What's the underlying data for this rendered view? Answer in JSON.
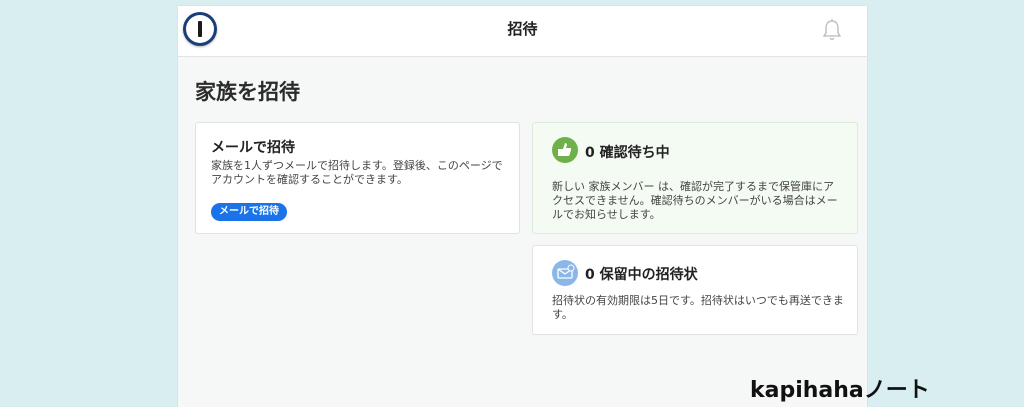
{
  "header": {
    "title": "招待",
    "logo_icon": "1password-logo-icon",
    "bell_icon": "bell-icon"
  },
  "page": {
    "title": "家族を招待"
  },
  "email_card": {
    "title": "メールで招待",
    "description": "家族を1人ずつメールで招待します。登録後、このページでアカウントを確認することができます。",
    "button_label": "メールで招待",
    "button_color": "#1a73e8"
  },
  "pending_card": {
    "icon": "thumbs-up-icon",
    "title": "0 確認待ち中",
    "description": "新しい 家族メンバー は、確認が完了するまで保管庫にアクセスできません。確認待ちのメンバーがいる場合はメールでお知らせします。",
    "accent_color": "#57a13a"
  },
  "held_card": {
    "icon": "held-invites-icon",
    "title": "0 保留中の招待状",
    "description": "招待状の有効期限は5日です。招待状はいつでも再送できます。"
  },
  "watermark": {
    "text": "kapihahaノート"
  }
}
